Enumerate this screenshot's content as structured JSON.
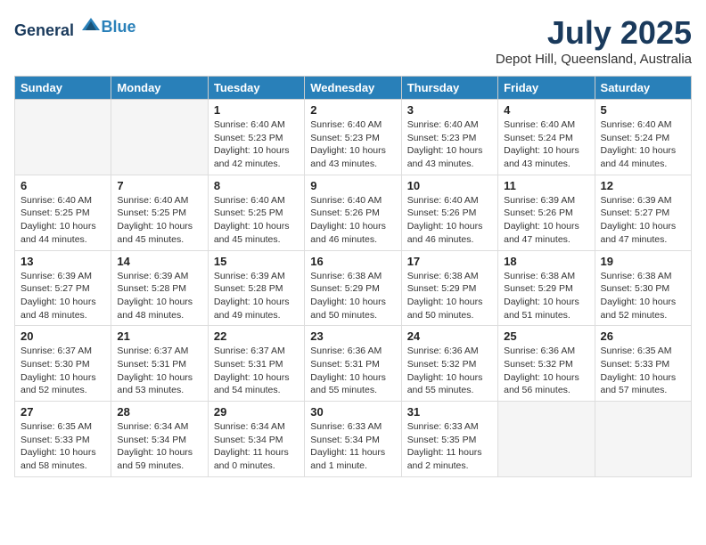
{
  "header": {
    "logo_general": "General",
    "logo_blue": "Blue",
    "month_year": "July 2025",
    "location": "Depot Hill, Queensland, Australia"
  },
  "days_of_week": [
    "Sunday",
    "Monday",
    "Tuesday",
    "Wednesday",
    "Thursday",
    "Friday",
    "Saturday"
  ],
  "weeks": [
    [
      {
        "day": "",
        "empty": true
      },
      {
        "day": "",
        "empty": true
      },
      {
        "day": "1",
        "sunrise": "6:40 AM",
        "sunset": "5:23 PM",
        "daylight": "10 hours and 42 minutes."
      },
      {
        "day": "2",
        "sunrise": "6:40 AM",
        "sunset": "5:23 PM",
        "daylight": "10 hours and 43 minutes."
      },
      {
        "day": "3",
        "sunrise": "6:40 AM",
        "sunset": "5:23 PM",
        "daylight": "10 hours and 43 minutes."
      },
      {
        "day": "4",
        "sunrise": "6:40 AM",
        "sunset": "5:24 PM",
        "daylight": "10 hours and 43 minutes."
      },
      {
        "day": "5",
        "sunrise": "6:40 AM",
        "sunset": "5:24 PM",
        "daylight": "10 hours and 44 minutes."
      }
    ],
    [
      {
        "day": "6",
        "sunrise": "6:40 AM",
        "sunset": "5:25 PM",
        "daylight": "10 hours and 44 minutes."
      },
      {
        "day": "7",
        "sunrise": "6:40 AM",
        "sunset": "5:25 PM",
        "daylight": "10 hours and 45 minutes."
      },
      {
        "day": "8",
        "sunrise": "6:40 AM",
        "sunset": "5:25 PM",
        "daylight": "10 hours and 45 minutes."
      },
      {
        "day": "9",
        "sunrise": "6:40 AM",
        "sunset": "5:26 PM",
        "daylight": "10 hours and 46 minutes."
      },
      {
        "day": "10",
        "sunrise": "6:40 AM",
        "sunset": "5:26 PM",
        "daylight": "10 hours and 46 minutes."
      },
      {
        "day": "11",
        "sunrise": "6:39 AM",
        "sunset": "5:26 PM",
        "daylight": "10 hours and 47 minutes."
      },
      {
        "day": "12",
        "sunrise": "6:39 AM",
        "sunset": "5:27 PM",
        "daylight": "10 hours and 47 minutes."
      }
    ],
    [
      {
        "day": "13",
        "sunrise": "6:39 AM",
        "sunset": "5:27 PM",
        "daylight": "10 hours and 48 minutes."
      },
      {
        "day": "14",
        "sunrise": "6:39 AM",
        "sunset": "5:28 PM",
        "daylight": "10 hours and 48 minutes."
      },
      {
        "day": "15",
        "sunrise": "6:39 AM",
        "sunset": "5:28 PM",
        "daylight": "10 hours and 49 minutes."
      },
      {
        "day": "16",
        "sunrise": "6:38 AM",
        "sunset": "5:29 PM",
        "daylight": "10 hours and 50 minutes."
      },
      {
        "day": "17",
        "sunrise": "6:38 AM",
        "sunset": "5:29 PM",
        "daylight": "10 hours and 50 minutes."
      },
      {
        "day": "18",
        "sunrise": "6:38 AM",
        "sunset": "5:29 PM",
        "daylight": "10 hours and 51 minutes."
      },
      {
        "day": "19",
        "sunrise": "6:38 AM",
        "sunset": "5:30 PM",
        "daylight": "10 hours and 52 minutes."
      }
    ],
    [
      {
        "day": "20",
        "sunrise": "6:37 AM",
        "sunset": "5:30 PM",
        "daylight": "10 hours and 52 minutes."
      },
      {
        "day": "21",
        "sunrise": "6:37 AM",
        "sunset": "5:31 PM",
        "daylight": "10 hours and 53 minutes."
      },
      {
        "day": "22",
        "sunrise": "6:37 AM",
        "sunset": "5:31 PM",
        "daylight": "10 hours and 54 minutes."
      },
      {
        "day": "23",
        "sunrise": "6:36 AM",
        "sunset": "5:31 PM",
        "daylight": "10 hours and 55 minutes."
      },
      {
        "day": "24",
        "sunrise": "6:36 AM",
        "sunset": "5:32 PM",
        "daylight": "10 hours and 55 minutes."
      },
      {
        "day": "25",
        "sunrise": "6:36 AM",
        "sunset": "5:32 PM",
        "daylight": "10 hours and 56 minutes."
      },
      {
        "day": "26",
        "sunrise": "6:35 AM",
        "sunset": "5:33 PM",
        "daylight": "10 hours and 57 minutes."
      }
    ],
    [
      {
        "day": "27",
        "sunrise": "6:35 AM",
        "sunset": "5:33 PM",
        "daylight": "10 hours and 58 minutes."
      },
      {
        "day": "28",
        "sunrise": "6:34 AM",
        "sunset": "5:34 PM",
        "daylight": "10 hours and 59 minutes."
      },
      {
        "day": "29",
        "sunrise": "6:34 AM",
        "sunset": "5:34 PM",
        "daylight": "11 hours and 0 minutes."
      },
      {
        "day": "30",
        "sunrise": "6:33 AM",
        "sunset": "5:34 PM",
        "daylight": "11 hours and 1 minute."
      },
      {
        "day": "31",
        "sunrise": "6:33 AM",
        "sunset": "5:35 PM",
        "daylight": "11 hours and 2 minutes."
      },
      {
        "day": "",
        "empty": true
      },
      {
        "day": "",
        "empty": true
      }
    ]
  ]
}
